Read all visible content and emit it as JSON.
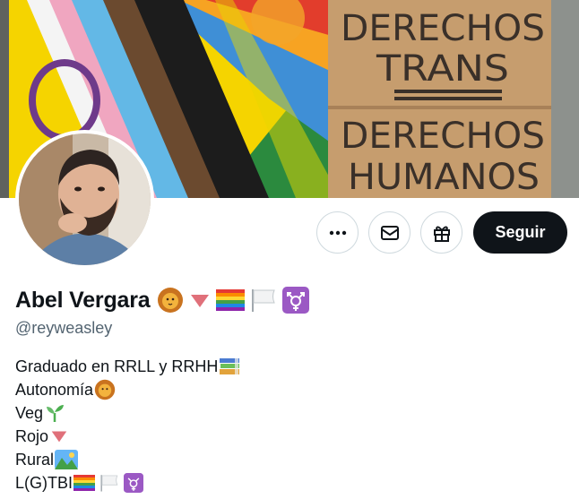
{
  "banner": {
    "sign_lines": [
      "DERECHOS",
      "TRANS",
      "DERECHOS",
      "HUMANOS"
    ]
  },
  "profile": {
    "display_name": "Abel Vergara",
    "handle": "@reyweasley",
    "name_emoji_icons": [
      "lion-face-icon",
      "red-triangle-down-icon",
      "rainbow-flag-icon",
      "white-flag-icon",
      "transgender-symbol-icon"
    ]
  },
  "actions": {
    "more_icon": "more-horizontal-icon",
    "message_icon": "envelope-icon",
    "gift_icon": "gift-icon",
    "follow_label": "Seguir"
  },
  "bio": {
    "lines": [
      {
        "text": "Graduado en RRLL y RRHH",
        "icon": "books-icon"
      },
      {
        "text": "Autonomía",
        "icon": "lion-face-icon"
      },
      {
        "text": "Veg",
        "icon": "seedling-icon"
      },
      {
        "text": "Rojo",
        "icon": "red-triangle-down-icon"
      },
      {
        "text": "Rural",
        "icon": "landscape-icon"
      },
      {
        "text": "L(G)TBI",
        "icons": [
          "rainbow-flag-icon",
          "white-flag-icon",
          "transgender-symbol-icon"
        ]
      }
    ]
  },
  "colors": {
    "follow_bg": "#0f1419",
    "handle": "#536471",
    "border": "#cfd9de",
    "cardboard": "#c39a6b",
    "marker": "#3a3029"
  }
}
